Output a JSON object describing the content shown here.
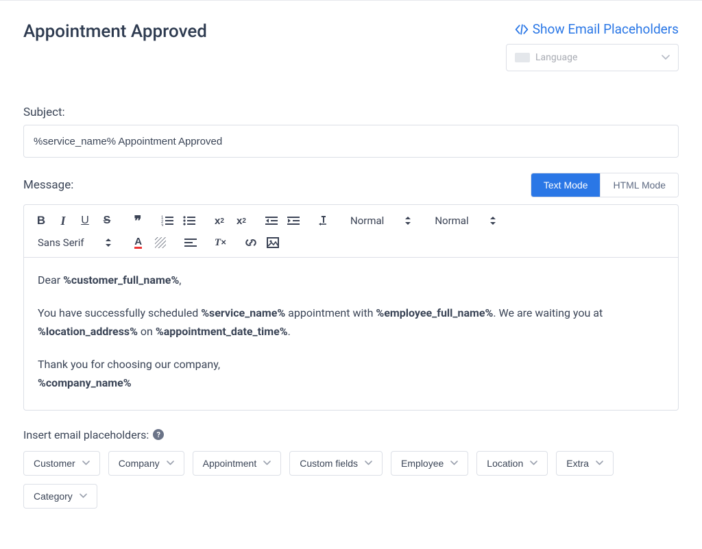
{
  "header": {
    "title": "Appointment Approved",
    "show_placeholders_label": "Show Email Placeholders",
    "language_placeholder": "Language"
  },
  "subject": {
    "label": "Subject:",
    "value": "%service_name% Appointment Approved"
  },
  "message": {
    "label": "Message:",
    "modes": {
      "text": "Text Mode",
      "html": "HTML Mode"
    },
    "toolbar": {
      "heading_value": "Normal",
      "size_value": "Normal",
      "font_value": "Sans Serif"
    },
    "body": {
      "greeting_prefix": "Dear ",
      "greeting_placeholder": "%customer_full_name%",
      "greeting_suffix": ",",
      "line2_a": "You have successfully scheduled ",
      "line2_b": "%service_name%",
      "line2_c": " appointment with ",
      "line2_d": "%employee_full_name%",
      "line2_e": ". We are waiting you at ",
      "line2_f": "%location_address%",
      "line2_g": " on ",
      "line2_h": "%appointment_date_time%",
      "line2_i": ".",
      "thanks": "Thank you for choosing our company,",
      "company_placeholder": "%company_name%"
    }
  },
  "insert": {
    "label": "Insert email placeholders:",
    "buttons": [
      "Customer",
      "Company",
      "Appointment",
      "Custom fields",
      "Employee",
      "Location",
      "Extra",
      "Category"
    ]
  }
}
